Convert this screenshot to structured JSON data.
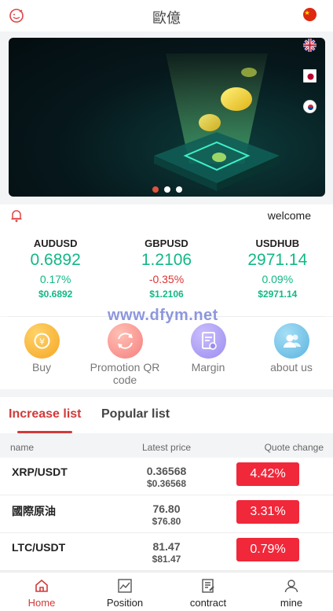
{
  "header": {
    "title": "歐億"
  },
  "notice": {
    "text": "welcome"
  },
  "banner": {
    "slides": 3,
    "active_slide": 1
  },
  "quotes": [
    {
      "symbol": "AUDUSD",
      "price": "0.6892",
      "change": "0.17%",
      "usd": "$0.6892",
      "direction": "up"
    },
    {
      "symbol": "GBPUSD",
      "price": "1.2106",
      "change": "-0.35%",
      "usd": "$1.2106",
      "direction": "down"
    },
    {
      "symbol": "USDHUB",
      "price": "2971.14",
      "change": "0.09%",
      "usd": "$2971.14",
      "direction": "up"
    }
  ],
  "watermark": "www.dfym.net",
  "menu": [
    {
      "label": "Buy",
      "icon": "buy-icon",
      "color": "#f5a623"
    },
    {
      "label": "Promotion QR code",
      "icon": "qr-exchange-icon",
      "color": "#f57f7f"
    },
    {
      "label": "Margin",
      "icon": "margin-doc-icon",
      "color": "#9b8ef0"
    },
    {
      "label": "about us",
      "icon": "about-users-icon",
      "color": "#5ab4e0"
    }
  ],
  "tabs": {
    "active": "Increase list",
    "inactive": "Popular list"
  },
  "table": {
    "headers": {
      "name": "name",
      "price": "Latest price",
      "change": "Quote change"
    },
    "rows": [
      {
        "name": "XRP/USDT",
        "price": "0.36568",
        "usd": "$0.36568",
        "change": "4.42%"
      },
      {
        "name": "國際原油",
        "price": "76.80",
        "usd": "$76.80",
        "change": "3.31%"
      },
      {
        "name": "LTC/USDT",
        "price": "81.47",
        "usd": "$81.47",
        "change": "0.79%"
      }
    ]
  },
  "nav": [
    {
      "label": "Home",
      "icon": "home-icon",
      "active": true
    },
    {
      "label": "Position",
      "icon": "chart-icon",
      "active": false
    },
    {
      "label": "contract",
      "icon": "contract-icon",
      "active": false
    },
    {
      "label": "mine",
      "icon": "user-icon",
      "active": false
    }
  ],
  "colors": {
    "accent": "#d23a3a",
    "up": "#12b886",
    "down": "#e03131",
    "badge": "#f0283a"
  }
}
